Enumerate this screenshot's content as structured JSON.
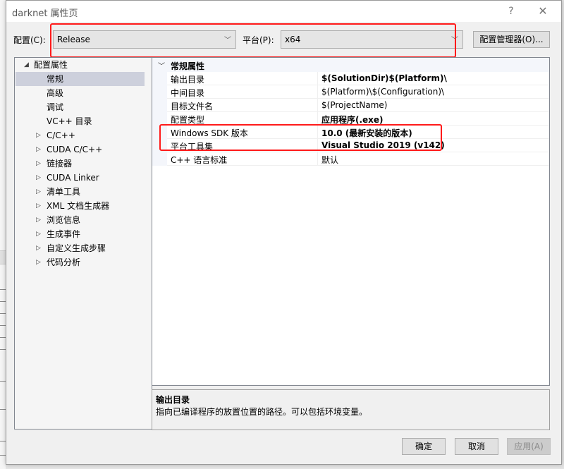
{
  "window": {
    "title": "darknet 属性页",
    "help_glyph": "?",
    "close_glyph": "✕"
  },
  "toolbar": {
    "config_label": "配置(C):",
    "config_value": "Release",
    "platform_label": "平台(P):",
    "platform_value": "x64",
    "dropdown_glyph": "﹀",
    "config_manager_label": "配置管理器(O)..."
  },
  "tree": {
    "root": {
      "label": "配置属性",
      "expander": "◢",
      "expanded": true
    },
    "items": [
      {
        "label": "常规",
        "selected": true,
        "has_children": false
      },
      {
        "label": "高级",
        "selected": false,
        "has_children": false
      },
      {
        "label": "调试",
        "selected": false,
        "has_children": false
      },
      {
        "label": "VC++ 目录",
        "selected": false,
        "has_children": false
      },
      {
        "label": "C/C++",
        "selected": false,
        "has_children": true
      },
      {
        "label": "CUDA C/C++",
        "selected": false,
        "has_children": true
      },
      {
        "label": "链接器",
        "selected": false,
        "has_children": true
      },
      {
        "label": "CUDA Linker",
        "selected": false,
        "has_children": true
      },
      {
        "label": "清单工具",
        "selected": false,
        "has_children": true
      },
      {
        "label": "XML 文档生成器",
        "selected": false,
        "has_children": true
      },
      {
        "label": "浏览信息",
        "selected": false,
        "has_children": true
      },
      {
        "label": "生成事件",
        "selected": false,
        "has_children": true
      },
      {
        "label": "自定义生成步骤",
        "selected": false,
        "has_children": true
      },
      {
        "label": "代码分析",
        "selected": false,
        "has_children": true
      }
    ],
    "collapsed_glyph": "▷"
  },
  "grid": {
    "category": {
      "label": "常规属性",
      "chevron": "﹀"
    },
    "properties": [
      {
        "name": "输出目录",
        "value": "$(SolutionDir)$(Platform)\\",
        "bold": true
      },
      {
        "name": "中间目录",
        "value": "$(Platform)\\$(Configuration)\\",
        "bold": false
      },
      {
        "name": "目标文件名",
        "value": "$(ProjectName)",
        "bold": false
      },
      {
        "name": "配置类型",
        "value": "应用程序(.exe)",
        "bold": true
      },
      {
        "name": "Windows SDK 版本",
        "value": "10.0 (最新安装的版本)",
        "bold": true
      },
      {
        "name": "平台工具集",
        "value": "Visual Studio 2019 (v142)",
        "bold": true
      },
      {
        "name": "C++ 语言标准",
        "value": "默认",
        "bold": false
      }
    ]
  },
  "description": {
    "title": "输出目录",
    "text": "指向已编译程序的放置位置的路径。可以包括环境变量。"
  },
  "buttons": {
    "ok": "确定",
    "cancel": "取消",
    "apply": "应用(A)"
  },
  "highlight_color": "#ff1a1a"
}
